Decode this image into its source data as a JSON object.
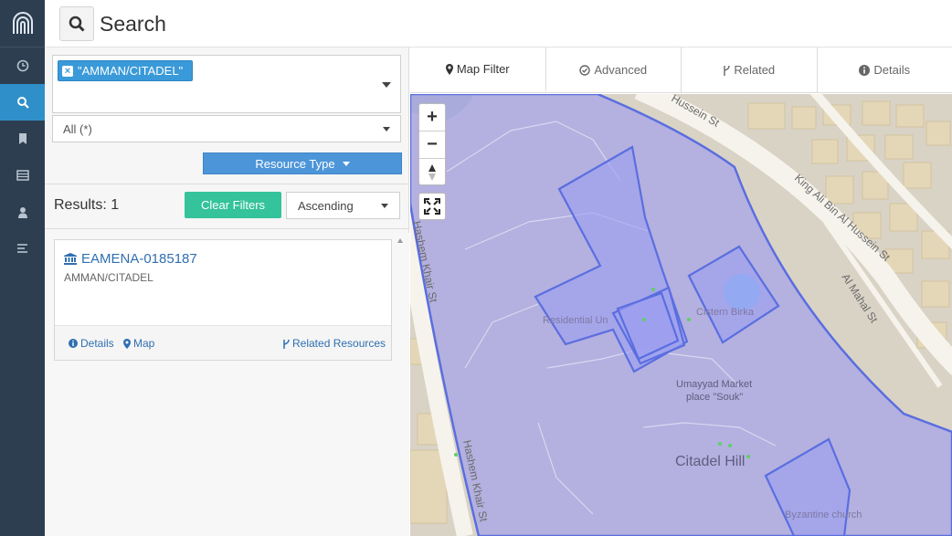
{
  "header": {
    "title": "Search"
  },
  "rail": {
    "items": [
      {
        "icon": "clock-icon",
        "active": false
      },
      {
        "icon": "search-icon",
        "active": true
      },
      {
        "icon": "bookmark-icon",
        "active": false
      },
      {
        "icon": "list-icon",
        "active": false
      },
      {
        "icon": "user-icon",
        "active": false
      },
      {
        "icon": "menu-icon",
        "active": false
      }
    ]
  },
  "filters": {
    "term": "\"AMMAN/CITADEL\"",
    "remove_label": "×",
    "scope": "All (*)",
    "resource_type_label": "Resource Type"
  },
  "results": {
    "label": "Results: 1",
    "clear_label": "Clear Filters",
    "sort_value": "Ascending",
    "items": [
      {
        "title": "EAMENA-0185187",
        "subtitle": "AMMAN/CITADEL",
        "details": "Details",
        "map": "Map",
        "related": "Related Resources"
      }
    ]
  },
  "tabs": [
    {
      "label": "Map Filter",
      "icon": "map-marker-icon",
      "active": true
    },
    {
      "label": "Advanced",
      "icon": "check-circle-icon",
      "active": false
    },
    {
      "label": "Related",
      "icon": "fork-icon",
      "active": false
    },
    {
      "label": "Details",
      "icon": "info-icon",
      "active": false
    }
  ],
  "map": {
    "labels": {
      "hussein_st": "Hussein St",
      "king_ali": "King Ali Bin Al Hussein St",
      "hashem_khair_1": "Hashem Khair St",
      "hashem_khair_2": "Hashem Khair St",
      "al_mahal": "Al Mahal St",
      "residential": "Residential Un",
      "cistern": "Cistern Birka",
      "market_line1": "Umayyad Market",
      "market_line2": "place \"Souk\"",
      "citadel_hill": "Citadel Hill",
      "byzantine": "Byzantine church"
    },
    "controls": {
      "zoom_in": "+",
      "zoom_out": "−"
    },
    "colors": {
      "overlay": "#a9a6e6",
      "outline": "#5a6ee0",
      "road": "#f5f2ea",
      "building": "#e0d3b4"
    }
  }
}
